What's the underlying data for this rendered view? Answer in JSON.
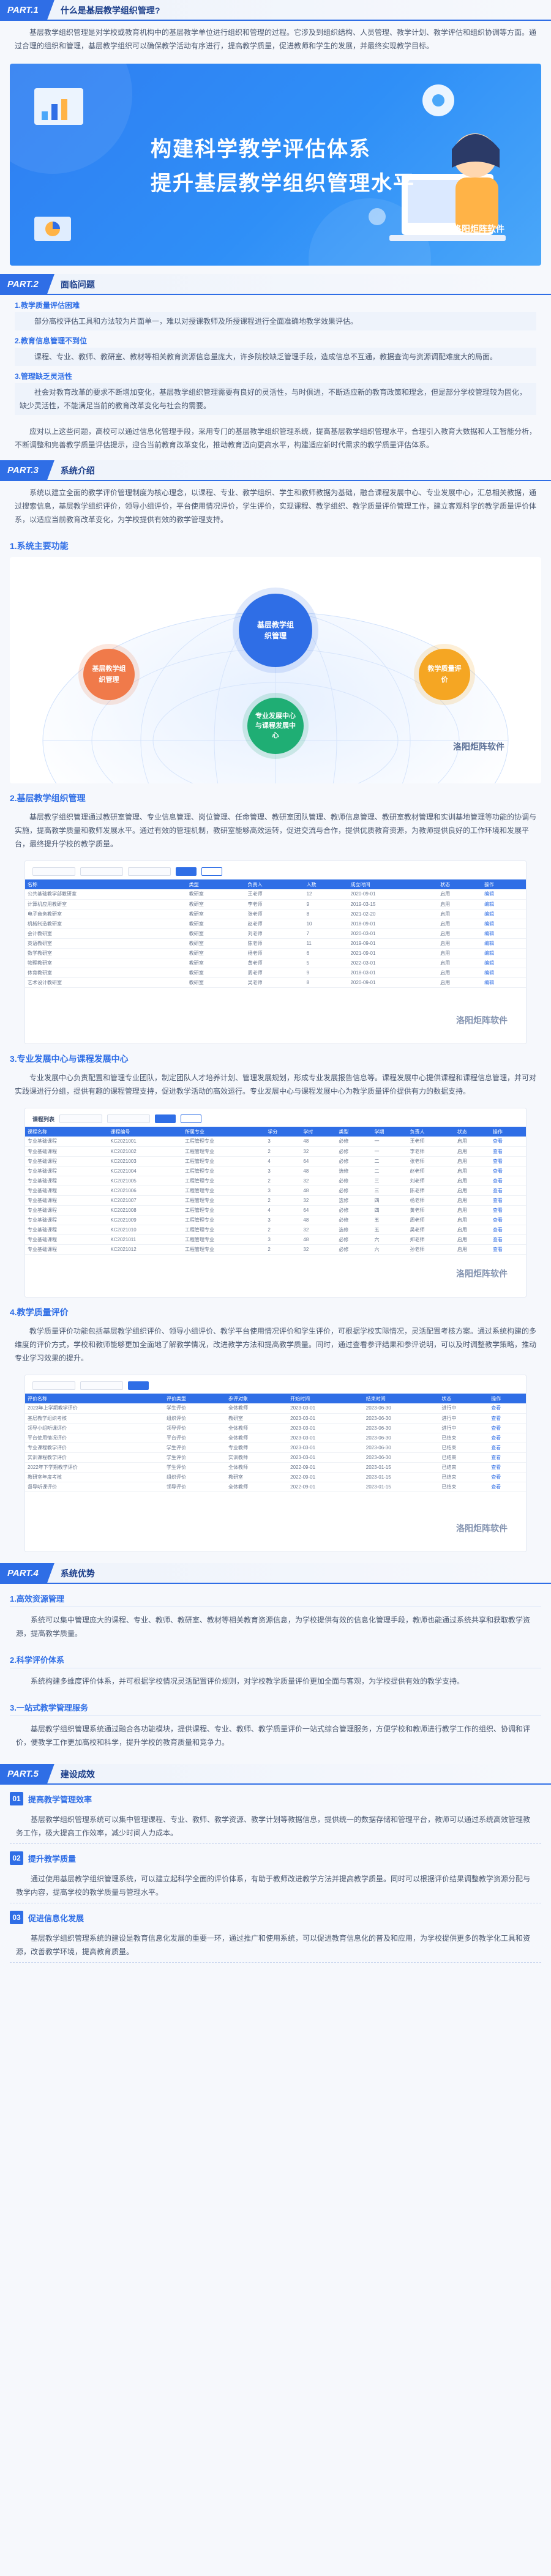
{
  "part1": {
    "tag": "PART.1",
    "title": "什么是基层教学组织管理?",
    "intro": "基层教学组织管理是对学校或教育机构中的基层教学单位进行组织和管理的过程。它涉及到组织结构、人员管理、教学计划、教学评估和组织协调等方面。通过合理的组织和管理，基层教学组织可以确保教学活动有序进行，提高教学质量，促进教师和学生的发展，并最终实现教学目标。",
    "banner_line1": "构建科学教学评估体系",
    "banner_line2": "提升基层教学组织管理水平",
    "banner_watermark": "洛阳炬阵软件"
  },
  "part2": {
    "tag": "PART.2",
    "title": "面临问题",
    "items": [
      {
        "title": "1.教学质量评估困难",
        "body": "部分高校评估工具和方法较为片面单一，难以对授课教师及所授课程进行全面准确地教学效果评估。"
      },
      {
        "title": "2.教育信息管理不到位",
        "body": "课程、专业、教师、教研室、教材等相关教育资源信息量庞大，许多院校缺乏管理手段，造成信息不互通，教据查询与资源调配难度大的局面。"
      },
      {
        "title": "3.管理缺乏灵活性",
        "body": "社会对教育改革的要求不断增加变化，基层教学组织管理需要有良好的灵活性，与时俱进，不断适应新的教育政策和理念，但是部分学校管理较为固化，缺少灵活性，不能满足当前的教育改革变化与社会的需要。"
      }
    ],
    "summary": "应对以上这些问题，高校可以通过信息化管理手段，采用专门的基层教学组织管理系统，提高基层教学组织管理水平，合理引入教育大数据和人工智能分析，不断调整和完善教学质量评估提示，迎合当前教育改革变化，推动教育迈向更高水平，构建适应新时代需求的教学质量评估体系。"
  },
  "part3": {
    "tag": "PART.3",
    "title": "系统介绍",
    "intro": "系统以建立全面的教学评价管理制度为核心理念，以课程、专业、教学组织、学生和教师教据为基础，融合课程发展中心、专业发展中心，汇总相关教据，通过搜索信息，基层教学组织评价，领导小组评价，平台使用情况评价，学生评价，实现课程、教学组织、教学质量评价管理工作，建立客观科学的教学质量评价体系，以适应当前教育改革变化，为学校提供有效的教学管理支持。",
    "features": {
      "heading": "1.系统主要功能",
      "center": "基层教学组织管理",
      "left": "基层教学组织管理",
      "right": "教学质量评价",
      "bottom": "专业发展中心与课程发展中心",
      "watermark": "洛阳炬阵软件"
    },
    "org": {
      "heading": "2.基层教学组织管理",
      "body": "基层教学组织管理通过教研室管理、专业信息管理、岗位管理、任命管理、教研室团队管理、教师信息管理、教研室教材管理和实训基地管理等功能的协调与实施，提高教学质量和教师发展水平。通过有效的管理机制，教研室能够高效运转，促进交流与合作，提供优质教育资源，为教师提供良好的工作环境和发展平台，最终提升学校的教学质量。",
      "watermark": "洛阳炬阵软件",
      "columns": [
        "名称",
        "类型",
        "负责人",
        "人数",
        "成立时间",
        "状态",
        "操作"
      ],
      "rows": [
        [
          "公共基础教学部教研室",
          "教研室",
          "王老师",
          "12",
          "2020-09-01",
          "启用",
          "编辑"
        ],
        [
          "计算机应用教研室",
          "教研室",
          "李老师",
          "9",
          "2019-03-15",
          "启用",
          "编辑"
        ],
        [
          "电子商务教研室",
          "教研室",
          "张老师",
          "8",
          "2021-02-20",
          "启用",
          "编辑"
        ],
        [
          "机械制造教研室",
          "教研室",
          "赵老师",
          "10",
          "2018-09-01",
          "启用",
          "编辑"
        ],
        [
          "会计教研室",
          "教研室",
          "刘老师",
          "7",
          "2020-03-01",
          "启用",
          "编辑"
        ],
        [
          "英语教研室",
          "教研室",
          "陈老师",
          "11",
          "2019-09-01",
          "启用",
          "编辑"
        ],
        [
          "数学教研室",
          "教研室",
          "杨老师",
          "6",
          "2021-09-01",
          "启用",
          "编辑"
        ],
        [
          "物理教研室",
          "教研室",
          "黄老师",
          "5",
          "2022-03-01",
          "启用",
          "编辑"
        ],
        [
          "体育教研室",
          "教研室",
          "周老师",
          "9",
          "2018-03-01",
          "启用",
          "编辑"
        ],
        [
          "艺术设计教研室",
          "教研室",
          "吴老师",
          "8",
          "2020-09-01",
          "启用",
          "编辑"
        ]
      ]
    },
    "dev": {
      "heading": "3.专业发展中心与课程发展中心",
      "body": "专业发展中心负责配置和管理专业团队，制定团队人才培养计划、管理发展规划，形成专业发展报告信息等。课程发展中心提供课程和课程信息管理，并可对实践课进行分组，提供有趣的课程管理支持，促进教学活动的高效运行。专业发展中心与课程发展中心为教学质量评价提供有力的数据支持。",
      "toolbar_label": "课程列表",
      "watermark": "洛阳炬阵软件",
      "columns": [
        "课程名称",
        "课程编号",
        "所属专业",
        "学分",
        "学时",
        "类型",
        "学期",
        "负责人",
        "状态",
        "操作"
      ],
      "rows": [
        [
          "专业基础课程",
          "KC2021001",
          "工程管理专业",
          "3",
          "48",
          "必修",
          "一",
          "王老师",
          "启用",
          "查看"
        ],
        [
          "专业基础课程",
          "KC2021002",
          "工程管理专业",
          "2",
          "32",
          "必修",
          "一",
          "李老师",
          "启用",
          "查看"
        ],
        [
          "专业基础课程",
          "KC2021003",
          "工程管理专业",
          "4",
          "64",
          "必修",
          "二",
          "张老师",
          "启用",
          "查看"
        ],
        [
          "专业基础课程",
          "KC2021004",
          "工程管理专业",
          "3",
          "48",
          "选修",
          "二",
          "赵老师",
          "启用",
          "查看"
        ],
        [
          "专业基础课程",
          "KC2021005",
          "工程管理专业",
          "2",
          "32",
          "必修",
          "三",
          "刘老师",
          "启用",
          "查看"
        ],
        [
          "专业基础课程",
          "KC2021006",
          "工程管理专业",
          "3",
          "48",
          "必修",
          "三",
          "陈老师",
          "启用",
          "查看"
        ],
        [
          "专业基础课程",
          "KC2021007",
          "工程管理专业",
          "2",
          "32",
          "选修",
          "四",
          "杨老师",
          "启用",
          "查看"
        ],
        [
          "专业基础课程",
          "KC2021008",
          "工程管理专业",
          "4",
          "64",
          "必修",
          "四",
          "黄老师",
          "启用",
          "查看"
        ],
        [
          "专业基础课程",
          "KC2021009",
          "工程管理专业",
          "3",
          "48",
          "必修",
          "五",
          "周老师",
          "启用",
          "查看"
        ],
        [
          "专业基础课程",
          "KC2021010",
          "工程管理专业",
          "2",
          "32",
          "选修",
          "五",
          "吴老师",
          "启用",
          "查看"
        ],
        [
          "专业基础课程",
          "KC2021011",
          "工程管理专业",
          "3",
          "48",
          "必修",
          "六",
          "郑老师",
          "启用",
          "查看"
        ],
        [
          "专业基础课程",
          "KC2021012",
          "工程管理专业",
          "2",
          "32",
          "必修",
          "六",
          "孙老师",
          "启用",
          "查看"
        ]
      ]
    },
    "eval": {
      "heading": "4.教学质量评价",
      "body": "教学质量评价功能包括基层教学组织评价、领导小组评价、教学平台使用情况评价和学生评价，可根据学校实际情况，灵活配置考核方案。通过系统构建的多维度的评价方式，学校和教师能够更加全面地了解教学情况，改进教学方法和提高教学质量。同时，通过查看参评结果和参评说明，可以及时调整教学策略，推动专业学习效果的提升。",
      "watermark": "洛阳炬阵软件",
      "columns": [
        "评价名称",
        "评价类型",
        "参评对象",
        "开始时间",
        "结束时间",
        "状态",
        "操作"
      ],
      "rows": [
        [
          "2023年上学期教学评价",
          "学生评价",
          "全体教师",
          "2023-03-01",
          "2023-06-30",
          "进行中",
          "查看"
        ],
        [
          "基层教学组织考核",
          "组织评价",
          "教研室",
          "2023-03-01",
          "2023-06-30",
          "进行中",
          "查看"
        ],
        [
          "领导小组听课评价",
          "领导评价",
          "全体教师",
          "2023-03-01",
          "2023-06-30",
          "进行中",
          "查看"
        ],
        [
          "平台使用情况评价",
          "平台评价",
          "全体教师",
          "2023-03-01",
          "2023-06-30",
          "已结束",
          "查看"
        ],
        [
          "专业课程教学评价",
          "学生评价",
          "专业教师",
          "2023-03-01",
          "2023-06-30",
          "已结束",
          "查看"
        ],
        [
          "实训课程教学评价",
          "学生评价",
          "实训教师",
          "2023-03-01",
          "2023-06-30",
          "已结束",
          "查看"
        ],
        [
          "2022年下学期教学评价",
          "学生评价",
          "全体教师",
          "2022-09-01",
          "2023-01-15",
          "已结束",
          "查看"
        ],
        [
          "教研室年度考核",
          "组织评价",
          "教研室",
          "2022-09-01",
          "2023-01-15",
          "已结束",
          "查看"
        ],
        [
          "督导听课评价",
          "领导评价",
          "全体教师",
          "2022-09-01",
          "2023-01-15",
          "已结束",
          "查看"
        ]
      ]
    }
  },
  "part4": {
    "tag": "PART.4",
    "title": "系统优势",
    "items": [
      {
        "title": "1.高效资源管理",
        "body": "系统可以集中管理庞大的课程、专业、教师、教研室、教材等相关教育资源信息，为学校提供有效的信息化管理手段，教师也能通过系统共享和获取教学资源，提高教学质量。"
      },
      {
        "title": "2.科学评价体系",
        "body": "系统构建多维度评价体系，并可根据学校情况灵活配置评价规则，对学校教学质量评价更加全面与客观，为学校提供有效的教学支持。"
      },
      {
        "title": "3.一站式教学管理服务",
        "body": "基层教学组织管理系统通过融合各功能模块，提供课程、专业、教师、教学质量评价一站式综合管理服务，方便学校和教师进行教学工作的组织、协调和评价，便教学工作更加高校和科学，提升学校的教育质量和竞争力。"
      }
    ]
  },
  "part5": {
    "tag": "PART.5",
    "title": "建设成效",
    "items": [
      {
        "num": "01",
        "title": "提高教学管理效率",
        "body": "基层教学组织管理系统可以集中管理课程、专业、教师、教学资源、教学计划等教据信息，提供统一的数据存储和管理平台，教师可以通过系统高效管理教务工作，极大提高工作效率，减少时间人力成本。"
      },
      {
        "num": "02",
        "title": "提升教学质量",
        "body": "通过使用基层教学组织管理系统，可以建立起科学全面的评价体系，有助于教师改进教学方法并提高教学质量。同时可以根据评价结果调整教学资源分配与教学内容，提高学校的教学质量与管理水平。"
      },
      {
        "num": "03",
        "title": "促进信息化发展",
        "body": "基层教学组织管理系统的建设是教育信息化发展的重要一环，通过推广和使用系统，可以促进教育信息化的普及和应用，为学校提供更多的教学化工具和资源，改善教学环境，提高教育质量。"
      }
    ]
  }
}
